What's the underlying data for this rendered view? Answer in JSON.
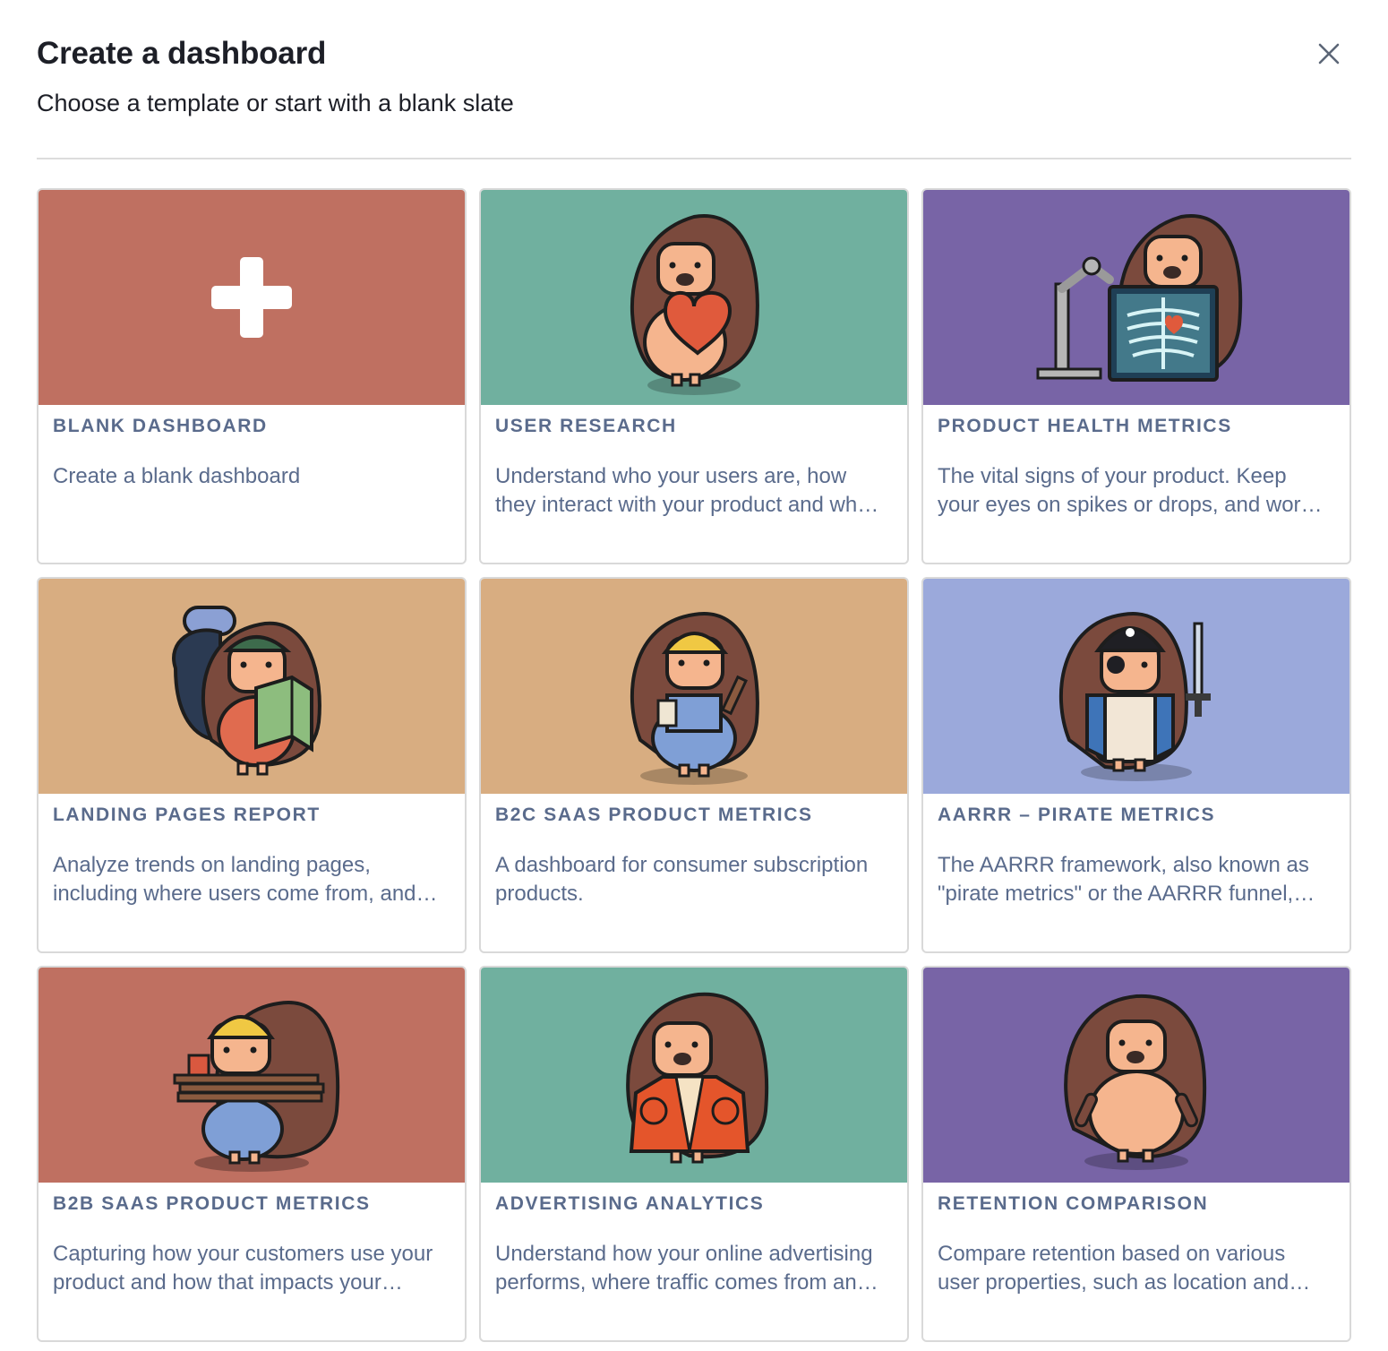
{
  "header": {
    "title": "Create a dashboard",
    "subtitle": "Choose a template or start with a blank slate",
    "close_icon": "close-icon"
  },
  "colors": {
    "terracotta": "#bf7061",
    "teal": "#70b09f",
    "purple": "#7864a6",
    "tan": "#d8ad81",
    "periwinkle": "#9ba9db",
    "label": "#5a6b8c"
  },
  "templates": [
    {
      "title": "BLANK DASHBOARD",
      "description": "Create a blank dashboard",
      "icon": "plus-icon",
      "bg": "#bf7061"
    },
    {
      "title": "USER RESEARCH",
      "description": "Understand who your users are, how they interact with your product and what they're looking for.",
      "icon": "hedgehog-heart-illustration",
      "bg": "#70b09f"
    },
    {
      "title": "PRODUCT HEALTH METRICS",
      "description": "The vital signs of your product. Keep your eyes on spikes or drops, and work out why they happen.",
      "icon": "hedgehog-xray-illustration",
      "bg": "#7864a6"
    },
    {
      "title": "LANDING PAGES REPORT",
      "description": "Analyze trends on landing pages, including where users come from, and how they convert.",
      "icon": "hedgehog-explorer-illustration",
      "bg": "#d8ad81"
    },
    {
      "title": "B2C SAAS PRODUCT METRICS",
      "description": "A dashboard for consumer subscription products.",
      "icon": "hedgehog-builder-illustration",
      "bg": "#d8ad81"
    },
    {
      "title": "AARRR – PIRATE METRICS",
      "description": "The AARRR framework, also known as \"pirate metrics\" or the AARRR funnel, tracks five key stages.",
      "icon": "hedgehog-pirate-illustration",
      "bg": "#9ba9db"
    },
    {
      "title": "B2B SAAS PRODUCT METRICS",
      "description": "Capturing how your customers use your product and how that impacts your business outcomes.",
      "icon": "hedgehog-lumber-illustration",
      "bg": "#bf7061"
    },
    {
      "title": "ADVERTISING ANALYTICS",
      "description": "Understand how your online advertising performs, where traffic comes from and how it converts.",
      "icon": "hedgehog-jacket-illustration",
      "bg": "#70b09f"
    },
    {
      "title": "RETENTION COMPARISON",
      "description": "Compare retention based on various user properties, such as location and device.",
      "icon": "hedgehog-plain-illustration",
      "bg": "#7864a6"
    }
  ]
}
